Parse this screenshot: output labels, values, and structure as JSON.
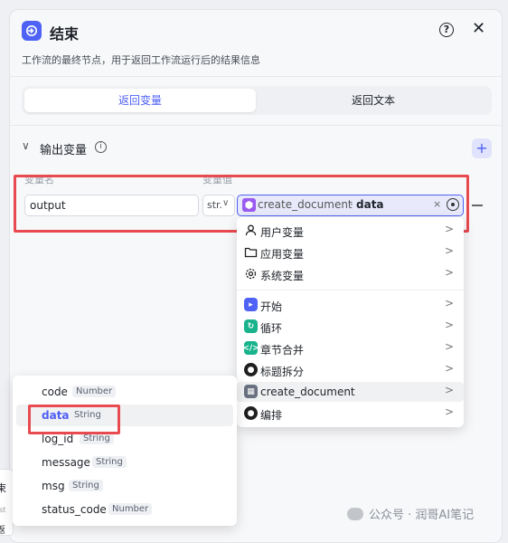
{
  "header": {
    "title": "结束",
    "description": "工作流的最终节点，用于返回工作流运行后的结果信息",
    "help_icon": "help-circle-icon",
    "close_icon": "close-icon"
  },
  "tabs": [
    {
      "label": "返回变量",
      "active": true
    },
    {
      "label": "返回文本",
      "active": false
    }
  ],
  "output_section": {
    "title": "输出变量",
    "col_name": "变量名",
    "col_value": "变量值",
    "row": {
      "name": "output",
      "type": "str.",
      "value_source": "create_document",
      "value_sep": "·",
      "value_var": "data",
      "clear_symbol": "×"
    }
  },
  "variable_menu": {
    "items": [
      {
        "label": "用户变量",
        "icon": "user-icon"
      },
      {
        "label": "应用变量",
        "icon": "folder-icon"
      },
      {
        "label": "系统变量",
        "icon": "gear-icon"
      },
      {
        "label": "开始",
        "icon": "start-node-icon",
        "color": "#4e63f5"
      },
      {
        "label": "循环",
        "icon": "loop-node-icon",
        "color": "#18b38d"
      },
      {
        "label": "章节合并",
        "icon": "code-node-icon",
        "color": "#18b38d"
      },
      {
        "label": "标题拆分",
        "icon": "robot-node-icon",
        "color": "#1f1f1f"
      },
      {
        "label": "create_document",
        "icon": "plugin-node-icon",
        "color": "#6a7282"
      },
      {
        "label": "编排",
        "icon": "robot-node-icon",
        "color": "#1f1f1f"
      }
    ],
    "selected": "create_document"
  },
  "field_menu": {
    "items": [
      {
        "name": "code",
        "type": "Number"
      },
      {
        "name": "data",
        "type": "String"
      },
      {
        "name": "log_id",
        "type": "String"
      },
      {
        "name": "message",
        "type": "String"
      },
      {
        "name": "msg",
        "type": "String"
      },
      {
        "name": "status_code",
        "type": "Number"
      }
    ],
    "selected": "data"
  },
  "canvas_node": {
    "line1": "束",
    "line2": "st",
    "line3": "返"
  },
  "watermark": "公众号 · 润哥AI笔记",
  "colors": {
    "accent": "#4e5ff5",
    "highlight": "#e84a4f"
  }
}
